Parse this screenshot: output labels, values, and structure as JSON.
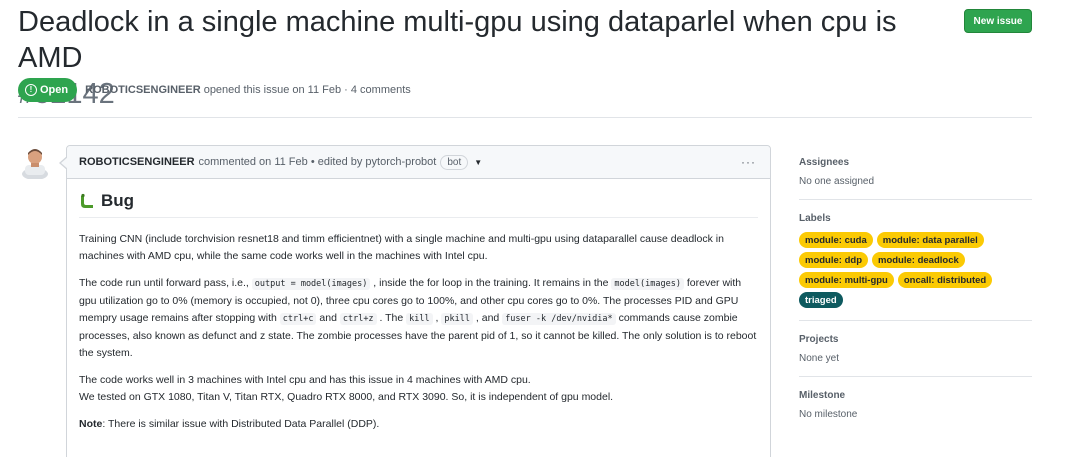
{
  "issue": {
    "title": "Deadlock in a single machine multi-gpu using dataparlel when cpu is AMD",
    "number": "#52142",
    "new_issue_label": "New issue",
    "state": "Open",
    "author": "ROBOTICSENGINEER",
    "meta": " opened this issue on 11 Feb · 4 comments"
  },
  "comment": {
    "author": "ROBOTICSENGINEER",
    "meta": "commented on 11 Feb • edited by pytorch-probot",
    "bot_badge": "bot",
    "more": "···",
    "heading": "Bug",
    "p1": "Training CNN (include torchvision resnet18 and timm efficientnet) with a single machine and multi-gpu using dataparallel cause deadlock in machines with AMD cpu, while the same code works well in the machines with Intel cpu.",
    "p2": {
      "t1": "The code run until forward pass, i.e., ",
      "c1": "output = model(images)",
      "t2": " , inside the for loop in the training. It remains in the ",
      "c2": "model(images)",
      "t3": " forever with gpu utilization go to 0% (memory is occupied, not 0), three cpu cores go to 100%, and other cpu cores go to 0%. The processes PID and GPU mempry usage remains after stopping with ",
      "c3": "ctrl+c",
      "t4": " and ",
      "c4": "ctrl+z",
      "t5": " . The ",
      "c5": "kill",
      "t6": " , ",
      "c6": "pkill",
      "t7": " , and ",
      "c7": "fuser -k /dev/nvidia*",
      "t8": " commands cause zombie processes, also known as defunct and z state. The zombie processes have the parent pid of 1, so it cannot be killed. The only solution is to reboot the system."
    },
    "p3_line1": "The code works well in 3 machines with Intel cpu and has this issue in 4 machines with AMD cpu.",
    "p3_line2": "We tested on GTX 1080, Titan V, Titan RTX, Quadro RTX 8000, and RTX 3090. So, it is independent of gpu model.",
    "p4_bold": "Note",
    "p4_rest": ": There is similar issue with Distributed Data Parallel (DDP)."
  },
  "sidebar": {
    "assignees_head": "Assignees",
    "assignees_val": "No one assigned",
    "labels_head": "Labels",
    "labels": [
      {
        "text": "module: cuda",
        "color": "#fbca04"
      },
      {
        "text": "module: data parallel",
        "color": "#fbca04"
      },
      {
        "text": "module: ddp",
        "color": "#fbca04"
      },
      {
        "text": "module: deadlock",
        "color": "#fbca04"
      },
      {
        "text": "module: multi-gpu",
        "color": "#fbca04"
      },
      {
        "text": "oncall: distributed",
        "color": "#fbca04"
      },
      {
        "text": "triaged",
        "color": "#0e5a5f"
      }
    ],
    "projects_head": "Projects",
    "projects_val": "None yet",
    "milestone_head": "Milestone",
    "milestone_val": "No milestone"
  },
  "colors": {
    "open_green": "#2ea44f",
    "label_yellow": "#fbca04",
    "label_teal": "#0e5a5f"
  },
  "icons": {
    "state": "issue-opened-icon",
    "bug": "bug-icon",
    "avatar": "user-avatar",
    "caret": "chevron-down-icon",
    "more": "kebab-horizontal-icon"
  }
}
